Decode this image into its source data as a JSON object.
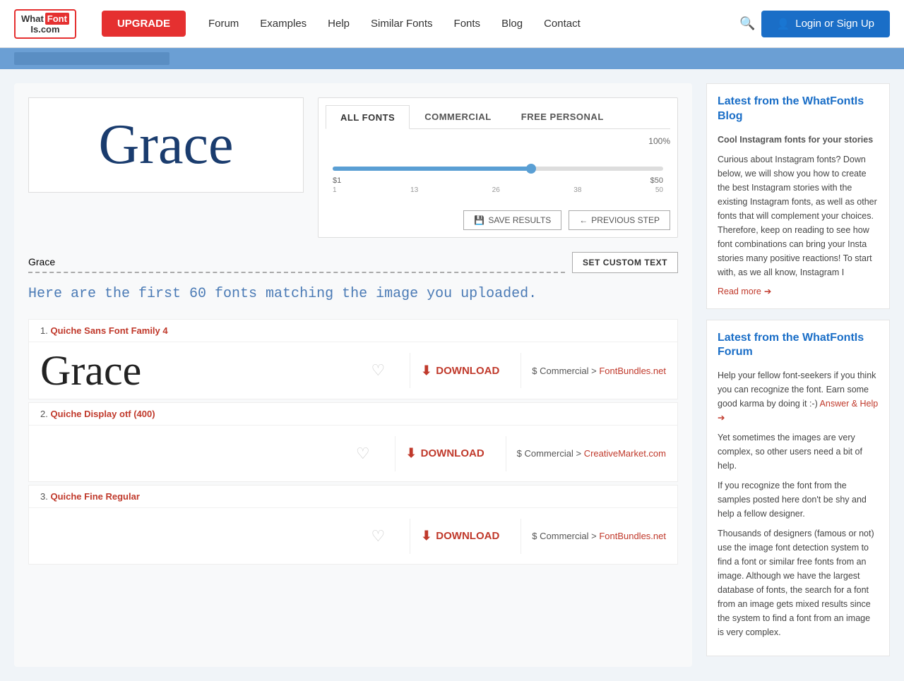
{
  "header": {
    "logo_line1": "What",
    "logo_font": "Font",
    "logo_line2": "Is.com",
    "upgrade_label": "UPGRADE",
    "nav_items": [
      "Forum",
      "Examples",
      "Help",
      "Similar Fonts",
      "Fonts",
      "Blog",
      "Contact"
    ],
    "login_label": "Login or Sign Up"
  },
  "filter": {
    "tabs": [
      {
        "label": "ALL FONTS",
        "active": true
      },
      {
        "label": "COMMERCIAL",
        "active": false
      },
      {
        "label": "FREE PERSONAL",
        "active": false
      }
    ],
    "price_display": "100%",
    "slider_min": "$1",
    "slider_max": "$50",
    "tick_values": [
      "1",
      "13",
      "26",
      "38",
      "50"
    ],
    "save_results_label": "SAVE RESULTS",
    "prev_step_label": "PREVIOUS STEP"
  },
  "custom_text": {
    "value": "Grace",
    "placeholder": "Grace",
    "button_label": "SET CUSTOM TEXT"
  },
  "matching_text": "Here are the first 60 fonts matching the image you uploaded.",
  "font_results": [
    {
      "rank": "1.",
      "name": "Quiche Sans Font Family 4",
      "link_label": "Quiche Sans Font Family 4",
      "sample_text": "Grace",
      "download_label": "DOWNLOAD",
      "commercial_text": "$ Commercial >",
      "commercial_site": "FontBundles.net"
    },
    {
      "rank": "2.",
      "name": "Quiche Display otf (400)",
      "link_label": "Quiche Display otf (400)",
      "sample_text": "",
      "download_label": "DOWNLOAD",
      "commercial_text": "$ Commercial >",
      "commercial_site": "CreativeMarket.com"
    },
    {
      "rank": "3.",
      "name": "Quiche Fine Regular",
      "link_label": "Quiche Fine Regular",
      "sample_text": "",
      "download_label": "DOWNLOAD",
      "commercial_text": "$ Commercial >",
      "commercial_site": "FontBundles.net"
    }
  ],
  "sidebar": {
    "blog_title": "Latest from the WhatFontIs Blog",
    "blog_post_title": "Cool Instagram fonts for your stories",
    "blog_post_text": "Curious about Instagram fonts? Down below, we will show you how to create the best Instagram stories with the existing Instagram fonts, as well as other fonts that will complement your choices. Therefore, keep on reading to see how font combinations can bring your Insta stories many positive reactions! To start with, as we all know, Instagram I",
    "blog_read_more": "Read more",
    "forum_title": "Latest from the WhatFontIs Forum",
    "forum_text1": "Help your fellow font-seekers if you think you can recognize the font. Earn some good karma by doing it :-)",
    "forum_link": "Answer & Help",
    "forum_text2": "Yet sometimes the images are very complex, so other users need a bit of help.",
    "forum_text3": "If you recognize the font from the samples posted here don't be shy and help a fellow designer.",
    "forum_text4": "Thousands of designers (famous or not) use the image font detection system to find a font or similar free fonts from an image. Although we have the largest database of fonts, the search for a font from an image gets mixed results since the system to find a font from an image is very complex."
  }
}
